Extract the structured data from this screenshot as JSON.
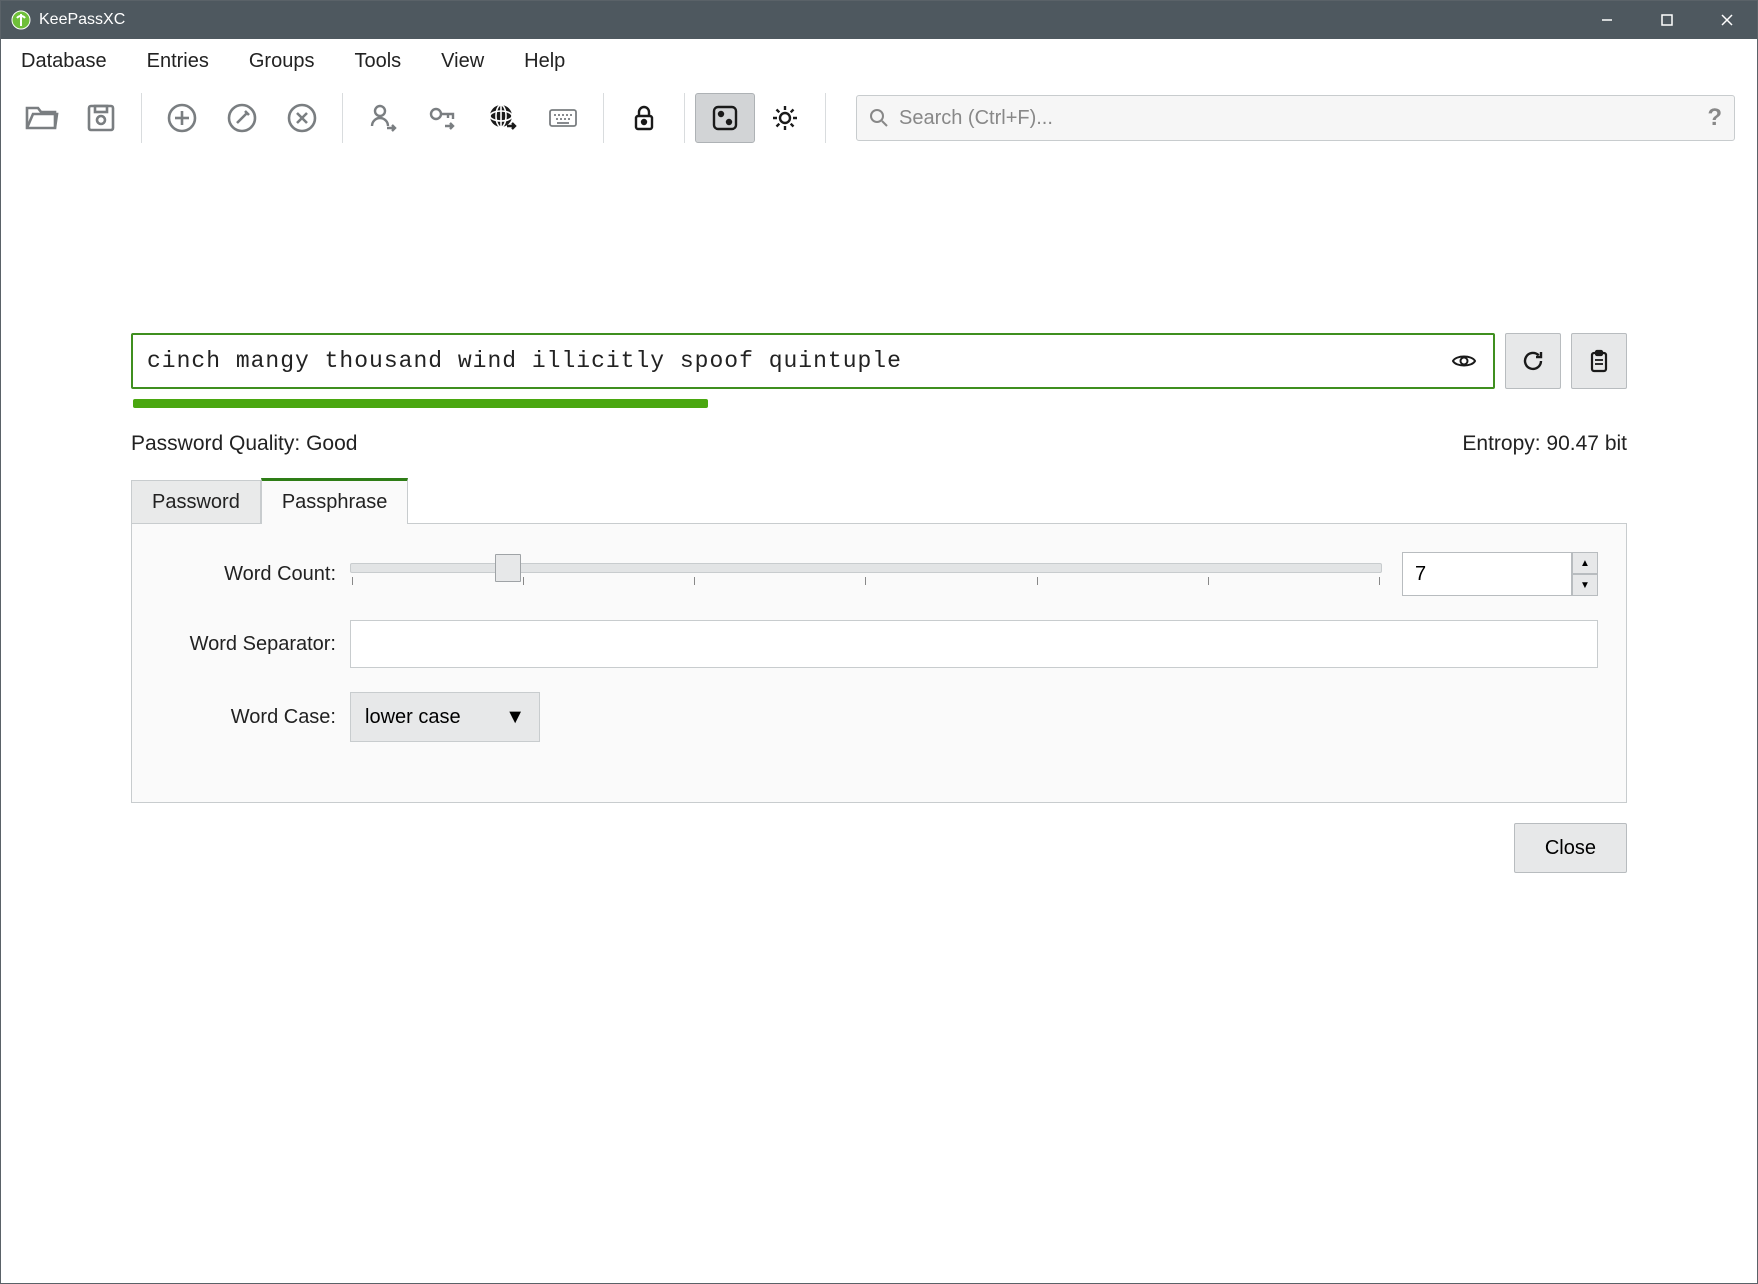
{
  "window": {
    "title": "KeePassXC"
  },
  "menubar": [
    "Database",
    "Entries",
    "Groups",
    "Tools",
    "View",
    "Help"
  ],
  "toolbar": {
    "search_placeholder": "Search (Ctrl+F)...",
    "help_symbol": "?"
  },
  "generator": {
    "password_value": "cinch mangy thousand wind illicitly spoof quintuple",
    "quality_label": "Password Quality: Good",
    "entropy_label": "Entropy: 90.47 bit",
    "tabs": {
      "password": "Password",
      "passphrase": "Passphrase",
      "active": "passphrase"
    },
    "fields": {
      "word_count_label": "Word Count:",
      "word_count_value": "7",
      "word_separator_label": "Word Separator:",
      "word_separator_value": "",
      "word_case_label": "Word Case:",
      "word_case_value": "lower case"
    },
    "close_label": "Close"
  }
}
